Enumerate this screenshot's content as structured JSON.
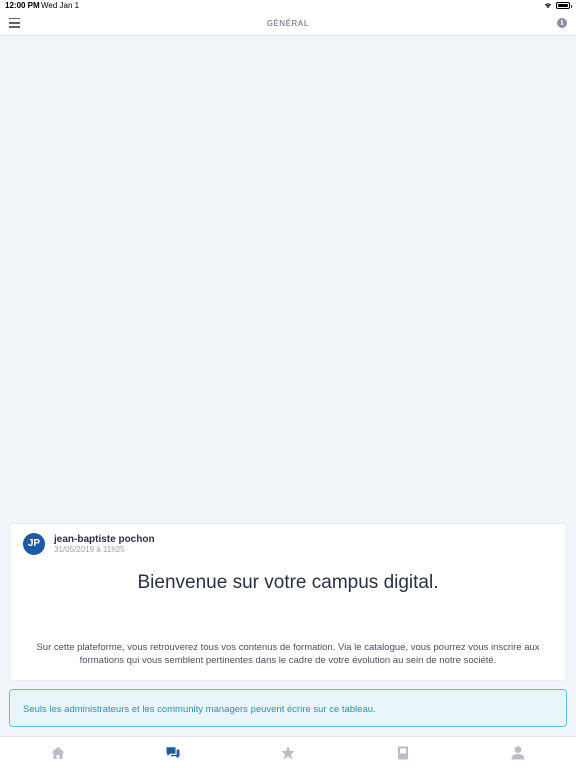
{
  "status_bar": {
    "time": "12:00 PM",
    "date": "Wed Jan 1"
  },
  "nav": {
    "title": "GÉNÉRAL"
  },
  "post": {
    "avatar_initials": "JP",
    "author": "jean-baptiste pochon",
    "date": "31/05/2019 à 11h25",
    "title": "Bienvenue sur votre campus digital.",
    "body": "Sur cette plateforme, vous retrouverez tous vos contenus de formation. Via le catalogue, vous pourrez vous inscrire aux formations qui vous semblent pertinentes dans le cadre de votre évolution au sein de notre société."
  },
  "notice": {
    "text": "Seuls les administrateurs et les community managers peuvent écrire sur ce tableau."
  },
  "tabs": [
    {
      "icon": "home-icon",
      "active": false
    },
    {
      "icon": "chat-icon",
      "active": true
    },
    {
      "icon": "star-icon",
      "active": false
    },
    {
      "icon": "book-icon",
      "active": false
    },
    {
      "icon": "user-icon",
      "active": false
    }
  ],
  "colors": {
    "accent": "#1a5ba3",
    "inactive_icon": "#b8bdc9",
    "notice_border": "#5fc2e0",
    "notice_text": "#2e8fb5",
    "background": "#f2f5f9"
  }
}
